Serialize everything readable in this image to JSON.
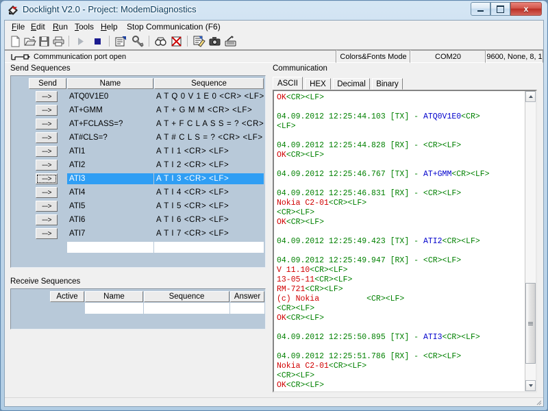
{
  "window": {
    "title": "Docklight V2.0 - Project: ModemDiagnostics",
    "app_icon": "docklight-logo-icon",
    "minimize_label": "Minimize",
    "maximize_label": "Maximize",
    "close_label": "x"
  },
  "menubar": {
    "items": [
      {
        "label": "File",
        "accel": "F"
      },
      {
        "label": "Edit",
        "accel": "E"
      },
      {
        "label": "Run",
        "accel": "R"
      },
      {
        "label": "Tools",
        "accel": "T"
      },
      {
        "label": "Help",
        "accel": "H"
      },
      {
        "label": "Stop Communication  (F6)",
        "accel": ""
      }
    ]
  },
  "toolbar": {
    "buttons": [
      {
        "name": "new-file-icon",
        "title": "New"
      },
      {
        "name": "open-file-icon",
        "title": "Open"
      },
      {
        "name": "save-file-icon",
        "title": "Save"
      },
      {
        "name": "print-icon",
        "title": "Print"
      },
      {
        "name": "start-communication-icon",
        "title": "Start Communication"
      },
      {
        "name": "stop-communication-icon",
        "title": "Stop Communication"
      },
      {
        "name": "project-settings-icon",
        "title": "Project Settings"
      },
      {
        "name": "communication-settings-icon",
        "title": "Communication Settings"
      },
      {
        "name": "find-icon",
        "title": "Find"
      },
      {
        "name": "clear-communication-icon",
        "title": "Clear Communication Window"
      },
      {
        "name": "edit-log-icon",
        "title": "Edit Log"
      },
      {
        "name": "snapshot-icon",
        "title": "Snapshot"
      },
      {
        "name": "keyboard-console-icon",
        "title": "Keyboard Console"
      }
    ]
  },
  "statusbar": {
    "port_status": "Commmunication port open",
    "mode": "Colors&Fonts Mode",
    "port": "COM20",
    "params": "9600, None, 8, 1",
    "plug_icon": "serial-plug-icon"
  },
  "send_sequences": {
    "label": "Send Sequences",
    "columns": [
      "Send",
      "Name",
      "Sequence"
    ],
    "send_button_label": "--->",
    "rows": [
      {
        "name": "ATQ0V1E0",
        "sequence": "A T Q 0 V 1 E 0 <CR> <LF>",
        "selected": false
      },
      {
        "name": "AT+GMM",
        "sequence": "A T + G M M <CR> <LF>",
        "selected": false
      },
      {
        "name": "AT+FCLASS=?",
        "sequence": "A T + F C L A S S = ? <CR> <LF>",
        "selected": false
      },
      {
        "name": "AT#CLS=?",
        "sequence": "A T # C L S = ? <CR> <LF>",
        "selected": false
      },
      {
        "name": "ATI1",
        "sequence": "A T I 1 <CR> <LF>",
        "selected": false
      },
      {
        "name": "ATI2",
        "sequence": "A T I 2 <CR> <LF>",
        "selected": false
      },
      {
        "name": "ATI3",
        "sequence": "A T I 3 <CR> <LF>",
        "selected": true
      },
      {
        "name": "ATI4",
        "sequence": "A T I 4 <CR> <LF>",
        "selected": false
      },
      {
        "name": "ATI5",
        "sequence": "A T I 5 <CR> <LF>",
        "selected": false
      },
      {
        "name": "ATI6",
        "sequence": "A T I 6 <CR> <LF>",
        "selected": false
      },
      {
        "name": "ATI7",
        "sequence": "A T I 7 <CR> <LF>",
        "selected": false
      },
      {
        "name": "",
        "sequence": "",
        "selected": false,
        "empty": true
      }
    ]
  },
  "receive_sequences": {
    "label": "Receive Sequences",
    "columns": [
      "Active",
      "Name",
      "Sequence",
      "Answer"
    ],
    "rows": [
      {
        "active": "",
        "name": "",
        "sequence": "",
        "answer": "",
        "empty": true
      }
    ]
  },
  "communication": {
    "label": "Communication",
    "tabs": [
      {
        "label": "ASCII",
        "active": true
      },
      {
        "label": "HEX",
        "active": false
      },
      {
        "label": "Decimal",
        "active": false
      },
      {
        "label": "Binary",
        "active": false
      }
    ],
    "colors": {
      "meta": "#008000",
      "rx_data": "#d00000",
      "tx_data": "#0000cc"
    },
    "log_lines": [
      [
        {
          "t": "OK",
          "c": "red"
        },
        {
          "t": "<CR><LF>",
          "c": "green"
        }
      ],
      [],
      [
        {
          "t": "04.09.2012 12:25:44.103 [TX] - ",
          "c": "green"
        },
        {
          "t": "ATQ0V1E0",
          "c": "blue"
        },
        {
          "t": "<CR>",
          "c": "green"
        }
      ],
      [
        {
          "t": "<LF>",
          "c": "green"
        }
      ],
      [],
      [
        {
          "t": "04.09.2012 12:25:44.828 [RX] - <CR><LF>",
          "c": "green"
        }
      ],
      [
        {
          "t": "OK",
          "c": "red"
        },
        {
          "t": "<CR><LF>",
          "c": "green"
        }
      ],
      [],
      [
        {
          "t": "04.09.2012 12:25:46.767 [TX] - ",
          "c": "green"
        },
        {
          "t": "AT+GMM",
          "c": "blue"
        },
        {
          "t": "<CR><LF>",
          "c": "green"
        }
      ],
      [],
      [
        {
          "t": "04.09.2012 12:25:46.831 [RX] - <CR><LF>",
          "c": "green"
        }
      ],
      [
        {
          "t": "Nokia C2-01",
          "c": "red"
        },
        {
          "t": "<CR><LF>",
          "c": "green"
        }
      ],
      [
        {
          "t": "<CR><LF>",
          "c": "green"
        }
      ],
      [
        {
          "t": "OK",
          "c": "red"
        },
        {
          "t": "<CR><LF>",
          "c": "green"
        }
      ],
      [],
      [
        {
          "t": "04.09.2012 12:25:49.423 [TX] - ",
          "c": "green"
        },
        {
          "t": "ATI2",
          "c": "blue"
        },
        {
          "t": "<CR><LF>",
          "c": "green"
        }
      ],
      [],
      [
        {
          "t": "04.09.2012 12:25:49.947 [RX] - <CR><LF>",
          "c": "green"
        }
      ],
      [
        {
          "t": "V 11.10",
          "c": "red"
        },
        {
          "t": "<CR><LF>",
          "c": "green"
        }
      ],
      [
        {
          "t": "13-05-11",
          "c": "red"
        },
        {
          "t": "<CR><LF>",
          "c": "green"
        }
      ],
      [
        {
          "t": "RM-721",
          "c": "red"
        },
        {
          "t": "<CR><LF>",
          "c": "green"
        }
      ],
      [
        {
          "t": "(c) Nokia          ",
          "c": "red"
        },
        {
          "t": "<CR><LF>",
          "c": "green"
        }
      ],
      [
        {
          "t": "<CR><LF>",
          "c": "green"
        }
      ],
      [
        {
          "t": "OK",
          "c": "red"
        },
        {
          "t": "<CR><LF>",
          "c": "green"
        }
      ],
      [],
      [
        {
          "t": "04.09.2012 12:25:50.895 [TX] - ",
          "c": "green"
        },
        {
          "t": "ATI3",
          "c": "blue"
        },
        {
          "t": "<CR><LF>",
          "c": "green"
        }
      ],
      [],
      [
        {
          "t": "04.09.2012 12:25:51.786 [RX] - <CR><LF>",
          "c": "green"
        }
      ],
      [
        {
          "t": "Nokia C2-01",
          "c": "red"
        },
        {
          "t": "<CR><LF>",
          "c": "green"
        }
      ],
      [
        {
          "t": "<CR><LF>",
          "c": "green"
        }
      ],
      [
        {
          "t": "OK",
          "c": "red"
        },
        {
          "t": "<CR><LF>",
          "c": "green"
        }
      ]
    ],
    "scrollbar": {
      "up_arrow": "scroll-up-icon",
      "down_arrow": "scroll-down-icon",
      "thumb": "scroll-thumb"
    }
  }
}
